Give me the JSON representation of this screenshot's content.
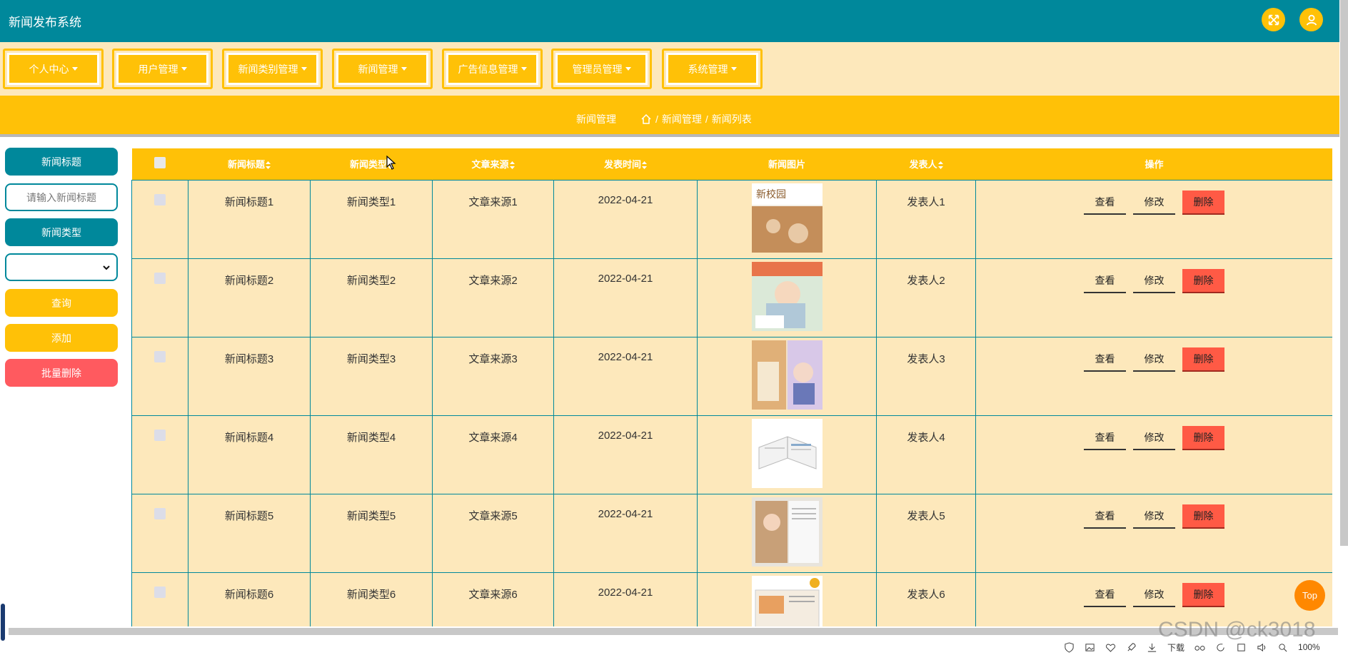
{
  "app": {
    "title": "新闻发布系统"
  },
  "nav": [
    {
      "label": "个人中心"
    },
    {
      "label": "用户管理"
    },
    {
      "label": "新闻类别管理"
    },
    {
      "label": "新闻管理"
    },
    {
      "label": "广告信息管理"
    },
    {
      "label": "管理员管理"
    },
    {
      "label": "系统管理"
    }
  ],
  "breadcrumb": {
    "title": "新闻管理",
    "path": [
      "新闻管理",
      "新闻列表"
    ],
    "separator": "/"
  },
  "search": {
    "title_label": "新闻标题",
    "title_placeholder": "请输入新闻标题",
    "type_label": "新闻类型",
    "type_value": "",
    "query_button": "查询",
    "add_button": "添加",
    "batch_delete_button": "批量删除"
  },
  "table": {
    "columns": [
      "新闻标题",
      "新闻类型",
      "文章来源",
      "发表时间",
      "新闻图片",
      "发表人",
      "操作"
    ],
    "actions": {
      "view": "查看",
      "edit": "修改",
      "delete": "删除"
    },
    "rows": [
      {
        "title": "新闻标题1",
        "type": "新闻类型1",
        "source": "文章来源1",
        "date": "2022-04-21",
        "author": "发表人1"
      },
      {
        "title": "新闻标题2",
        "type": "新闻类型2",
        "source": "文章来源2",
        "date": "2022-04-21",
        "author": "发表人2"
      },
      {
        "title": "新闻标题3",
        "type": "新闻类型3",
        "source": "文章来源3",
        "date": "2022-04-21",
        "author": "发表人3"
      },
      {
        "title": "新闻标题4",
        "type": "新闻类型4",
        "source": "文章来源4",
        "date": "2022-04-21",
        "author": "发表人4"
      },
      {
        "title": "新闻标题5",
        "type": "新闻类型5",
        "source": "文章来源5",
        "date": "2022-04-21",
        "author": "发表人5"
      },
      {
        "title": "新闻标题6",
        "type": "新闻类型6",
        "source": "文章来源6",
        "date": "2022-04-21",
        "author": "发表人6"
      }
    ]
  },
  "top_button": "Top",
  "watermark": "CSDN @ck3018",
  "statusbar": {
    "download": "下载",
    "zoom": "100%"
  },
  "colors": {
    "teal": "#00889b",
    "yellow": "#ffc107",
    "cream": "#fde8bb",
    "red": "#ff5a5f",
    "orange": "#ff8800"
  }
}
